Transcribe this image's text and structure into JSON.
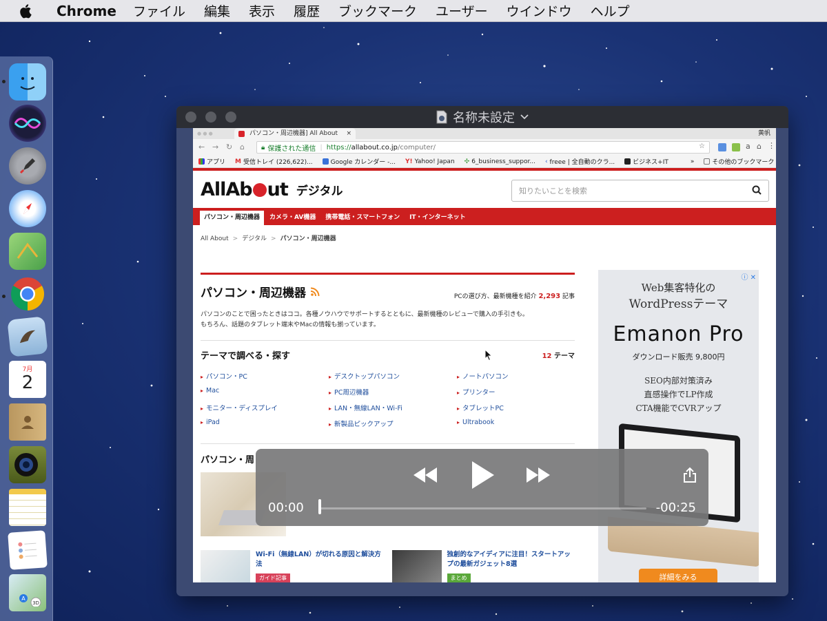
{
  "menubar": {
    "app_name": "Chrome",
    "items": [
      "ファイル",
      "編集",
      "表示",
      "履歴",
      "ブックマーク",
      "ユーザー",
      "ウインドウ",
      "ヘルプ"
    ]
  },
  "dock": {
    "apps": [
      "finder-icon",
      "siri-icon",
      "launchpad-icon",
      "safari-icon",
      "maps-icon",
      "chrome-icon",
      "mail-icon",
      "calendar-icon",
      "contacts-icon",
      "photo-booth-icon",
      "notes-icon",
      "reminders-icon",
      "maps-app-icon"
    ],
    "calendar": {
      "month": "7月",
      "day": "2"
    }
  },
  "quicktime": {
    "title": "名称未設定",
    "player": {
      "elapsed": "00:00",
      "remaining": "-00:25",
      "progress": 0.0
    }
  },
  "browser": {
    "tab_title": "パソコン・周辺機器] All About",
    "user_label": "黄帆",
    "secure_label": "保護された通信",
    "url_https": "https://",
    "url_host": "allabout.co.jp",
    "url_path": "/computer/",
    "bookmarks": [
      "アプリ",
      "受信トレイ (226,622)...",
      "Google カレンダー -...",
      "Yahoo! Japan",
      "6_business_suppor...",
      "freee | 全自動のクラ...",
      "ビジネス+IT"
    ],
    "bookmarks_more": "»",
    "other_bookmarks": "その他のブックマーク"
  },
  "site": {
    "logo_pre": "AllAb",
    "logo_post": "ut",
    "section_name": "デジタル",
    "search_placeholder": "知りたいことを検索",
    "nav": [
      "パソコン・周辺機器",
      "カメラ・AV機器",
      "携帯電話・スマートフォン",
      "IT・インターネット"
    ],
    "breadcrumb": [
      "All About",
      "デジタル",
      "パソコン・周辺機器"
    ],
    "category_title": "パソコン・周辺機器",
    "category_count_prefix": "PCの選び方、最新機種を紹介",
    "category_count_num": "2,293",
    "category_count_suffix": "記事",
    "category_desc_1": "パソコンのことで困ったときはココ。各種ノウハウでサポートするとともに、最新機種のレビューで購入の手引きも。",
    "category_desc_2": "もちろん、話題のタブレット端末やMacの情報も揃っています。",
    "theme_title": "テーマで調べる・探す",
    "theme_count_num": "12",
    "theme_count_suffix": "テーマ",
    "themes": [
      "パソコン・PC",
      "デスクトップパソコン",
      "ノートパソコン",
      "Mac",
      "PC周辺機器",
      "プリンター",
      "モニター・ディスプレイ",
      "LAN・無線LAN・Wi-Fi",
      "タブレットPC",
      "iPad",
      "新製品ピックアップ",
      "Ultrabook"
    ],
    "section2_title": "パソコン・周",
    "articles": [
      {
        "title": "Wi-Fi（無線LAN）が切れる原因と解決方法",
        "badge": "ガイド記事",
        "badge_color": "#d8425a"
      },
      {
        "title": "独創的なアイディアに注目！スタートアップの最新ガジェット8選",
        "badge": "まとめ",
        "badge_color": "#5aa83a"
      }
    ]
  },
  "ad": {
    "line1": "Web集客特化の",
    "line2": "WordPressテーマ",
    "brand": "Emanon Pro",
    "price": "ダウンロード販売 9,800円",
    "features": [
      "SEO内部対策済み",
      "直感操作でLP作成",
      "CTA機能でCVRアップ"
    ],
    "cta": "詳細をみる"
  },
  "colors": {
    "allabout_red": "#cc1f1f",
    "link_blue": "#1f4e9c",
    "ad_orange": "#f08a1e"
  }
}
